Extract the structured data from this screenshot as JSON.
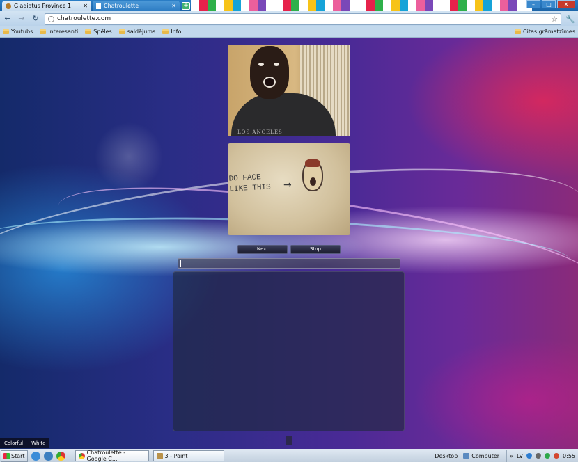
{
  "browser": {
    "tabs": [
      {
        "title": "Gladiatus Province 1",
        "active": false
      },
      {
        "title": "Chatroulette",
        "active": true
      }
    ],
    "window_buttons": {
      "minimize": "–",
      "maximize": "□",
      "close": "✕"
    },
    "address": "chatroulette.com",
    "bookmarks": [
      "Youtubs",
      "Interesanti",
      "Spēles",
      "saldējums",
      "Info"
    ],
    "other_bookmarks": "Citas grāmatzīmes"
  },
  "page": {
    "partner_sign_text": "DO FACE\nLIKE THIS",
    "partner_shirt_text": "LOS ANGELES",
    "buttons": {
      "next": "Next",
      "stop": "Stop"
    },
    "chat_input_value": "",
    "theme_links": [
      "Colorful",
      "White"
    ]
  },
  "taskbar": {
    "start_label": "Start",
    "tasks": [
      {
        "label": "Chatroulette - Google C...",
        "icon": "chrome-icon"
      },
      {
        "label": "3 - Paint",
        "icon": "paint-icon"
      }
    ],
    "desktop_label": "Desktop",
    "computer_label": "Computer",
    "overflow": "»",
    "language": "LV",
    "clock": "0:55"
  },
  "colors": {
    "tab_bar": "#2b7ec6",
    "page_left": "#142a6a",
    "page_right": "#8a2a7a",
    "button_dark": "#1c1d2e"
  }
}
